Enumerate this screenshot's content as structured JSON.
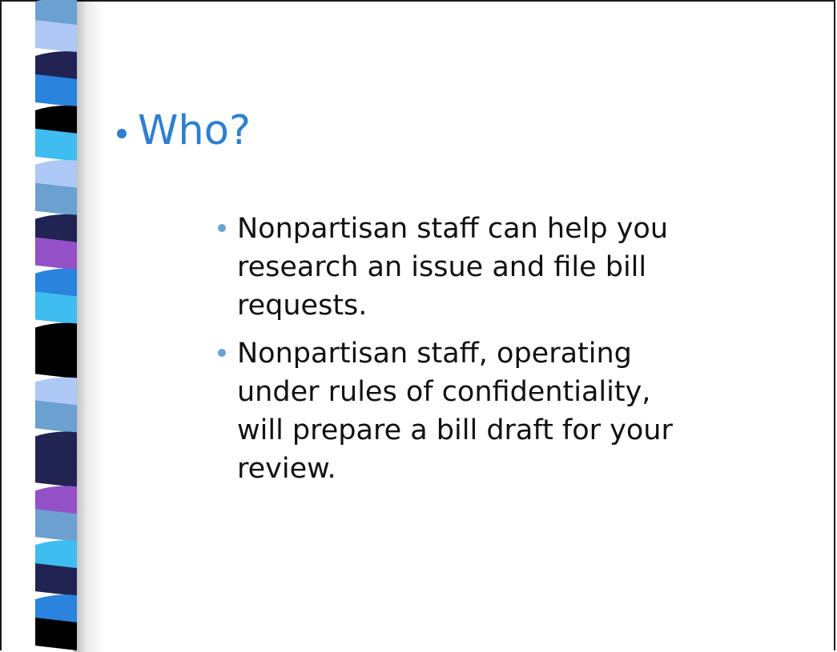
{
  "slide": {
    "title": "Who?",
    "bullets": [
      {
        "lines": [
          "Nonpartisan staff can help you",
          "research an issue and file bill",
          "requests."
        ]
      },
      {
        "lines": [
          "Nonpartisan staff, operating",
          "under rules of confidentiality,",
          "will prepare a bill draft for your",
          "review."
        ]
      }
    ]
  },
  "colors": {
    "title": "#2f7ed0",
    "bullet_dot": "#6aa1d6",
    "text": "#111111",
    "stripe_palette": [
      "#6ba0d0",
      "#aec9f5",
      "#212452",
      "#2a84dd",
      "#000000",
      "#3fbdf0",
      "#9451c7"
    ]
  }
}
